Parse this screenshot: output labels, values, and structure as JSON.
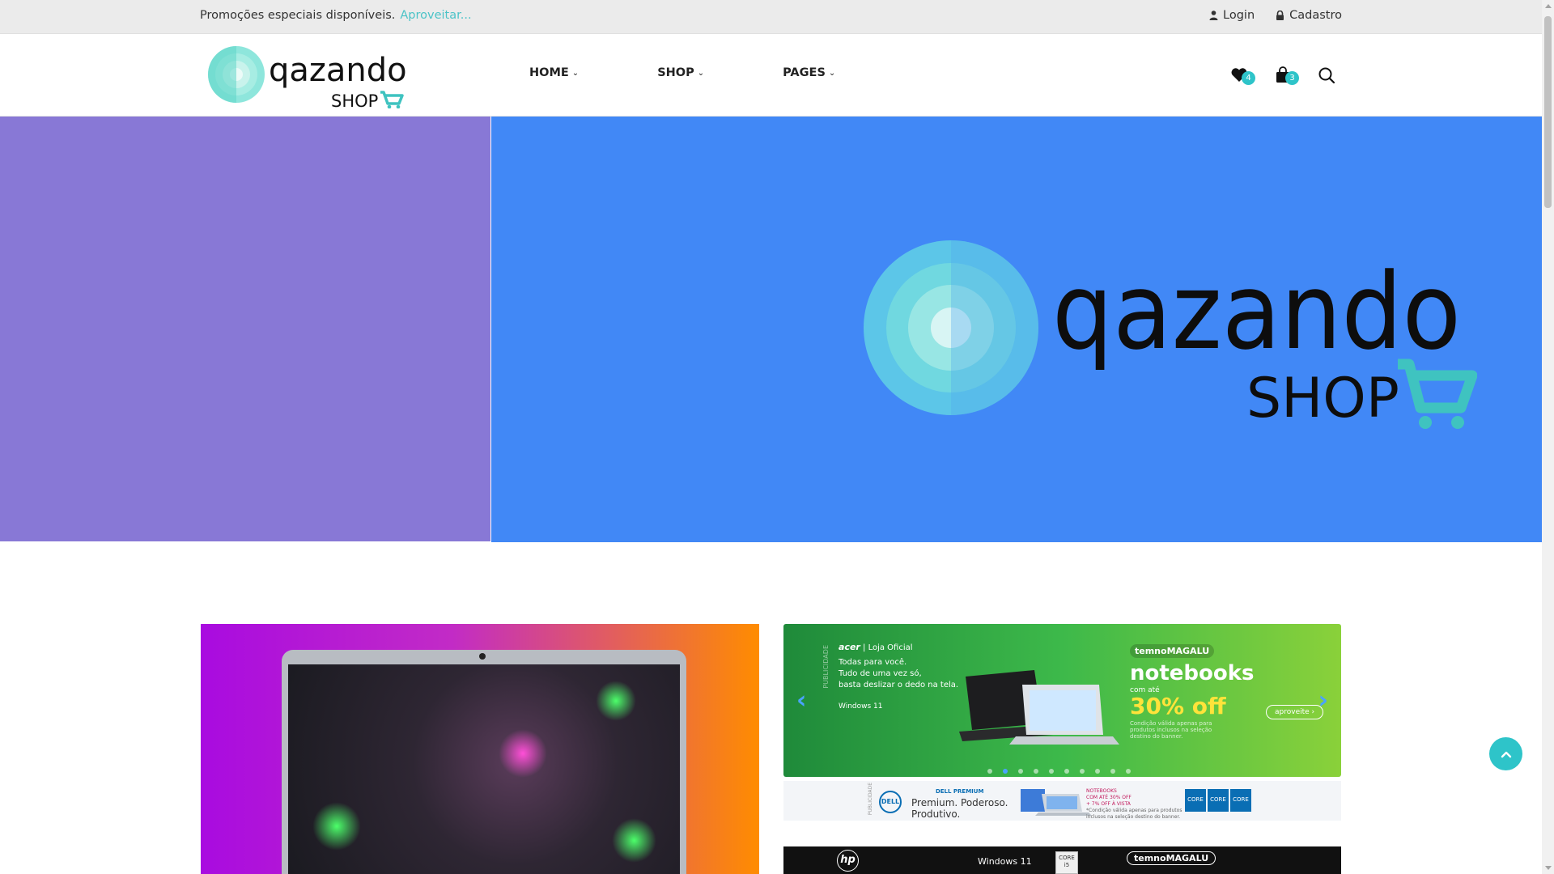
{
  "topbar": {
    "promo_text": "Promoções especiais disponíveis.",
    "promo_link": "Aproveitar...",
    "login_label": "Login",
    "signup_label": "Cadastro"
  },
  "header": {
    "logo_alt": "Qazando Shop",
    "logo_word": "qazando",
    "logo_sub": "SHOP",
    "nav": [
      {
        "label": "HOME"
      },
      {
        "label": "SHOP"
      },
      {
        "label": "PAGES"
      }
    ],
    "wishlist_count": "4",
    "cart_count": "3"
  },
  "hero": {
    "logo_word": "qazando",
    "logo_sub": "SHOP"
  },
  "banners": {
    "carousel": {
      "side_label": "PUBLICIDADE",
      "acer_brand": "acer",
      "acer_store": "Loja Oficial",
      "acer_copy_1": "Todas para você.",
      "acer_copy_2": "Tudo de uma vez só,",
      "acer_copy_3": "basta deslizar o dedo na tela.",
      "acer_windows": "Windows 11",
      "tnm": "temnoMAGALU",
      "title": "notebooks",
      "with_up_to": "com até",
      "discount": "30% off",
      "cta": "aproveite ›",
      "fine_print": "Condição válida apenas para produtos inclusos na seleção destino do banner.",
      "dots": 10,
      "active_dot": 2
    },
    "dell": {
      "side_label": "PUBLICIDADE",
      "logo": "DELL",
      "kicker": "DELL PREMIUM",
      "line1": "Premium. Poderoso.",
      "line2": "Produtivo.",
      "deal_1": "NOTEBOOKS",
      "deal_2": "COM ATÉ 30% OFF",
      "deal_3": "+ 7% OFF À VISTA",
      "deal_fine": "*Condição válida apenas para produtos inclusos na seleção destino do banner.",
      "core_1": "CORE",
      "core_2": "CORE",
      "core_3": "CORE"
    },
    "hp": {
      "logo": "hp",
      "windows": "Windows 11",
      "core": "CORE i5",
      "tnm": "temnoMAGALU"
    }
  },
  "colors": {
    "accent": "#2ec4c9",
    "hero_left": "#8878d6",
    "hero_right": "#4188f6"
  }
}
